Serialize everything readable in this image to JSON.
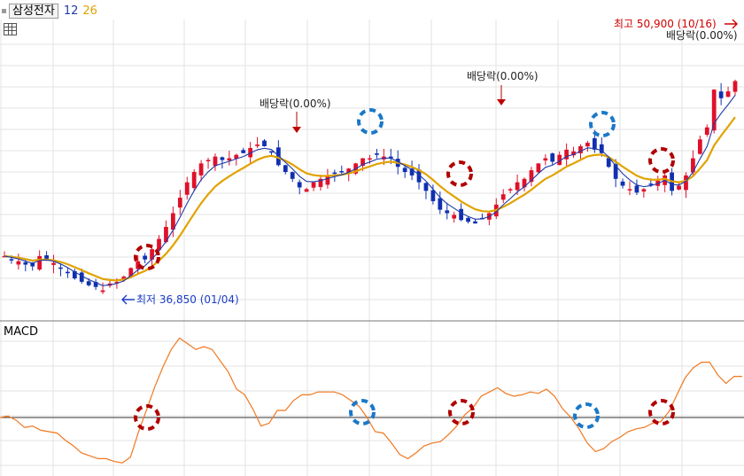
{
  "header": {
    "stock_name": "삼성전자",
    "ma_short": "12",
    "ma_long": "26",
    "ma_short_color": "#1f3ba8",
    "ma_long_color": "#e1a300"
  },
  "toolbar": {
    "grid_icon": "table-grid-icon"
  },
  "macd_panel": {
    "label": "MACD",
    "line_color": "#f07820"
  },
  "annotations": {
    "high_label": "최고 50,900 (10/16)",
    "low_label": "최저 36,850 (01/04)",
    "dividend_labels": [
      "배당락(0.00%)",
      "배당락(0.00%)",
      "배당락(0.00%)"
    ],
    "buy_marker_color": "#b00000",
    "sell_marker_color": "#1a78c8"
  },
  "chart_data": [
    {
      "type": "candlestick",
      "panel": "price",
      "series": [
        {
          "name": "12",
          "color": "#1f3ba8"
        },
        {
          "name": "26",
          "color": "#e1a300"
        }
      ],
      "y": [
        38900,
        38700,
        38600,
        38400,
        38300,
        38900,
        38700,
        38500,
        38200,
        37900,
        37600,
        37400,
        37200,
        37100,
        36900,
        37300,
        37400,
        37700,
        38200,
        38600,
        38700,
        39300,
        39900,
        40600,
        41400,
        42300,
        43200,
        43800,
        44300,
        44500,
        44700,
        44500,
        44600,
        44800,
        44900,
        45200,
        45400,
        45300,
        45000,
        44200,
        43800,
        43400,
        42900,
        42800,
        43200,
        43400,
        43600,
        43700,
        43800,
        44000,
        44300,
        44600,
        44600,
        44800,
        44700,
        44600,
        44100,
        43800,
        43600,
        43200,
        42700,
        42100,
        41600,
        41400,
        41300,
        41000,
        40900,
        40800,
        41100,
        41400,
        41900,
        42500,
        42800,
        43200,
        43400,
        43900,
        44300,
        44600,
        44400,
        44800,
        45100,
        45000,
        45300,
        45500,
        45100,
        44900,
        44100,
        43400,
        43000,
        42800,
        42600,
        42800,
        43100,
        43300,
        43600,
        42700,
        43000,
        43600,
        44600,
        45700,
        46400,
        48600,
        48100,
        48500,
        49100
      ],
      "low_label": "최저 36,850 (01/04)",
      "high_label": "최고 50,900 (10/16)"
    },
    {
      "type": "line",
      "panel": "macd",
      "title": "MACD",
      "series": [
        {
          "name": "MACD",
          "values": [
            0,
            0.05,
            -0.1,
            -0.35,
            -0.3,
            -0.45,
            -0.5,
            -0.55,
            -0.8,
            -1.0,
            -1.25,
            -1.35,
            -1.45,
            -1.45,
            -1.55,
            -1.6,
            -1.4,
            -0.5,
            0.3,
            1.1,
            1.8,
            2.4,
            2.8,
            2.6,
            2.4,
            2.5,
            2.4,
            2.0,
            1.6,
            1.0,
            0.8,
            0.3,
            -0.3,
            -0.2,
            0.25,
            0.25,
            0.6,
            0.8,
            0.8,
            0.9,
            0.9,
            0.9,
            0.8,
            0.6,
            0.4,
            0.0,
            -0.5,
            -0.55,
            -0.9,
            -1.3,
            -1.45,
            -1.25,
            -1.0,
            -0.9,
            -0.85,
            -0.6,
            -0.3,
            0.1,
            0.35,
            0.75,
            0.9,
            1.05,
            0.85,
            0.75,
            0.8,
            0.9,
            0.85,
            1.0,
            0.75,
            0.3,
            0.0,
            -0.4,
            -0.9,
            -1.2,
            -1.1,
            -0.85,
            -0.7,
            -0.5,
            -0.4,
            -0.35,
            -0.2,
            -0.15,
            0.2,
            0.8,
            1.4,
            1.75,
            1.95,
            1.95,
            1.5,
            1.2,
            1.45,
            1.45
          ]
        }
      ]
    }
  ]
}
